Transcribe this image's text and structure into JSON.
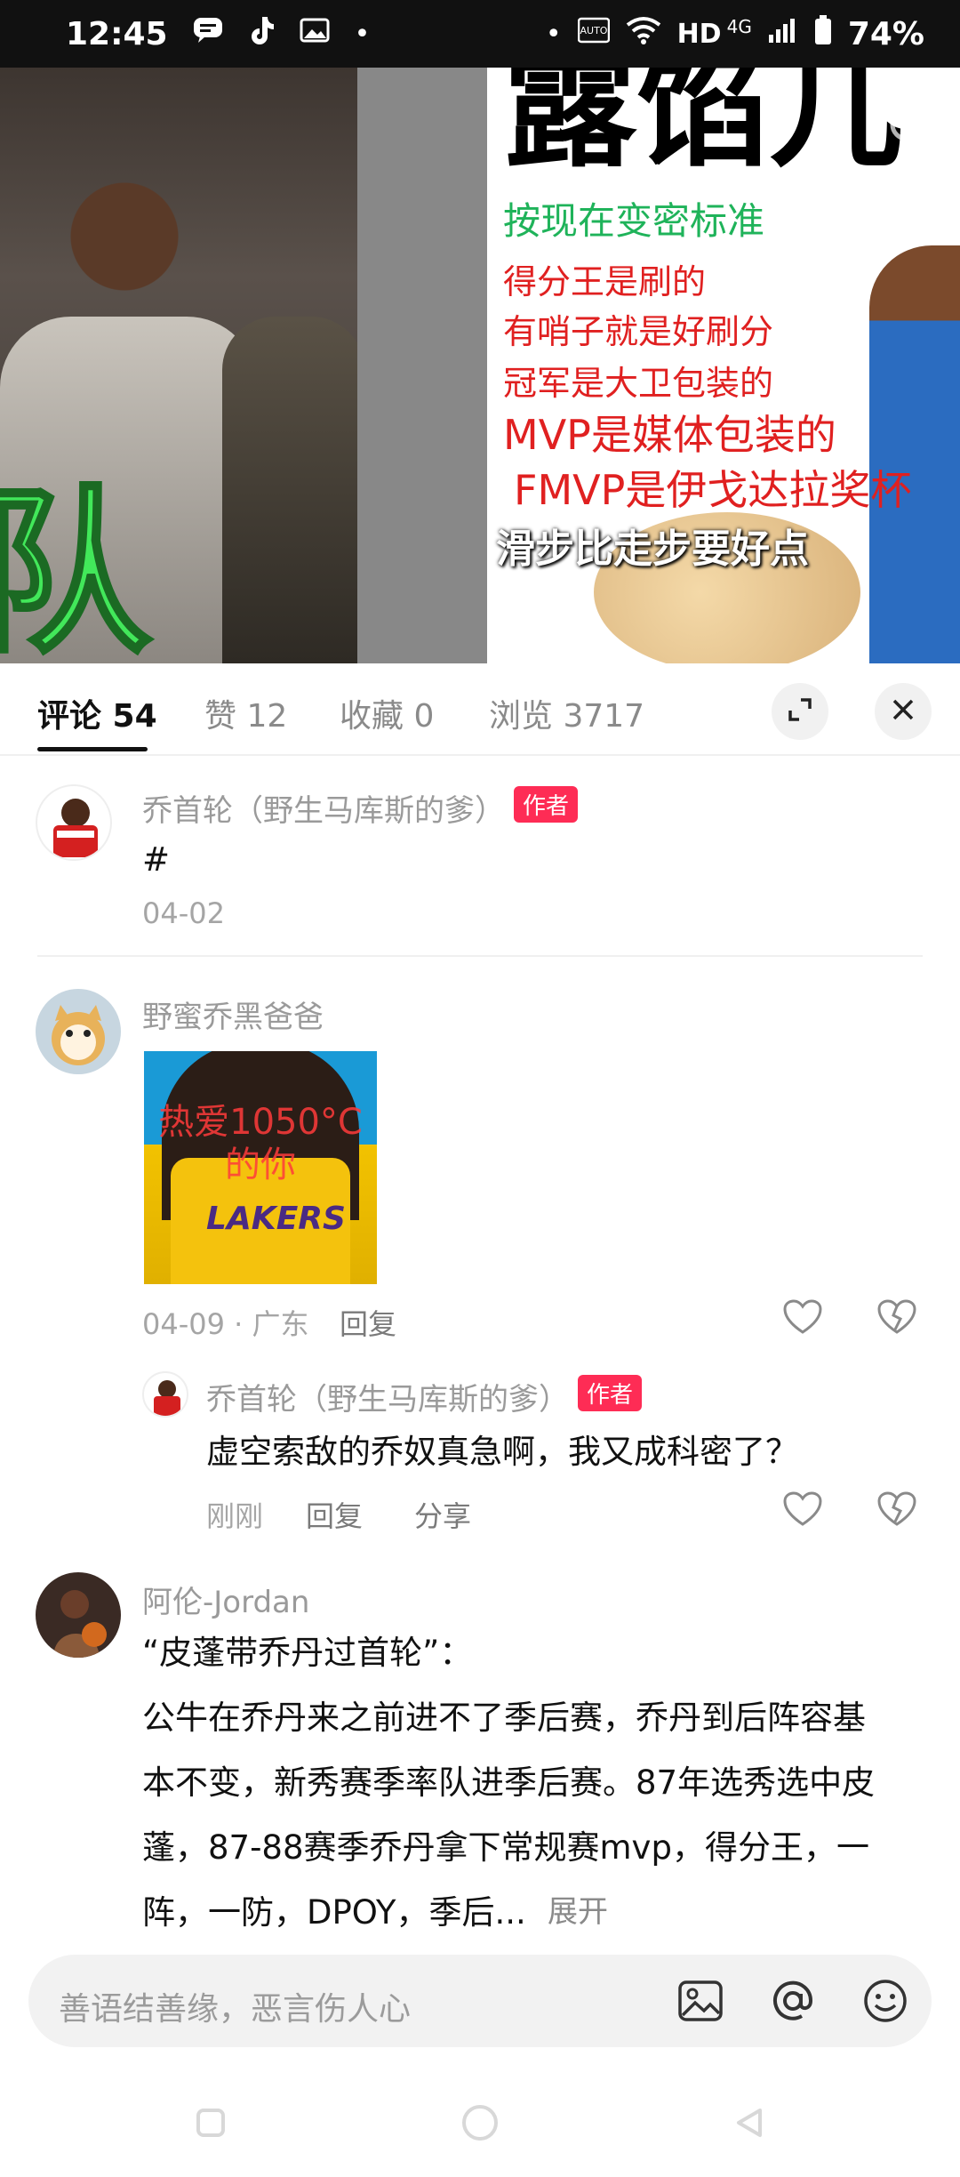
{
  "status_bar": {
    "time": "12:45",
    "network": "HD",
    "network_gen": "4G",
    "battery": "74%",
    "left_icons": [
      "chat-bubble-icon",
      "tiktok-icon",
      "image-icon"
    ],
    "right_icons": [
      "auto-icon",
      "wifi-icon",
      "signal-icon",
      "battery-icon"
    ]
  },
  "video": {
    "meme_title": "露馅儿",
    "meme_lines": [
      "按现在变密标准",
      "得分王是刷的",
      "有哨子就是好刷分",
      "冠军是大卫包装的",
      "MVP是媒体包装的",
      "FMVP是伊戈达拉奖杯"
    ],
    "left_overlay": "队",
    "subtitle": "滑步比走步要好点"
  },
  "tabs": [
    {
      "label": "评论 54",
      "active": true
    },
    {
      "label": "赞 12",
      "active": false
    },
    {
      "label": "收藏 0",
      "active": false
    },
    {
      "label": "浏览 3717",
      "active": false
    }
  ],
  "comments": {
    "c1": {
      "username": "乔首轮（野生马库斯的爹）",
      "badge": "作者",
      "text": "#",
      "date": "04-02"
    },
    "c2": {
      "username": "野蜜乔黑爸爸",
      "image_overlay": "热爱1050°C的你",
      "image_jersey": "LAKERS",
      "meta": "04-09 · 广东",
      "reply_label": "回复"
    },
    "c2_reply": {
      "username": "乔首轮（野生马库斯的爹）",
      "badge": "作者",
      "text": "虚空索敌的乔奴真急啊，我又成科密了？",
      "time": "刚刚",
      "reply_label": "回复",
      "share_label": "分享"
    },
    "c3": {
      "username": "阿伦-Jordan",
      "line1": "“皮蓬带乔丹过首轮”：",
      "line2": "公牛在乔丹来之前进不了季后赛，乔丹到后阵容基",
      "line3": "本不变，新秀赛季率队进季后赛。87年选秀选中皮",
      "line4": "蓬，87-88赛季乔丹拿下常规赛mvp，得分王，一",
      "line5": "阵，一防，DPOY，季后...",
      "more_label": "展开"
    }
  },
  "input": {
    "placeholder": "善语结善缘，恶言伤人心"
  },
  "colors": {
    "author_badge": "#fe2c55",
    "active_tab": "#111111",
    "muted_text": "#9a9a9a"
  }
}
